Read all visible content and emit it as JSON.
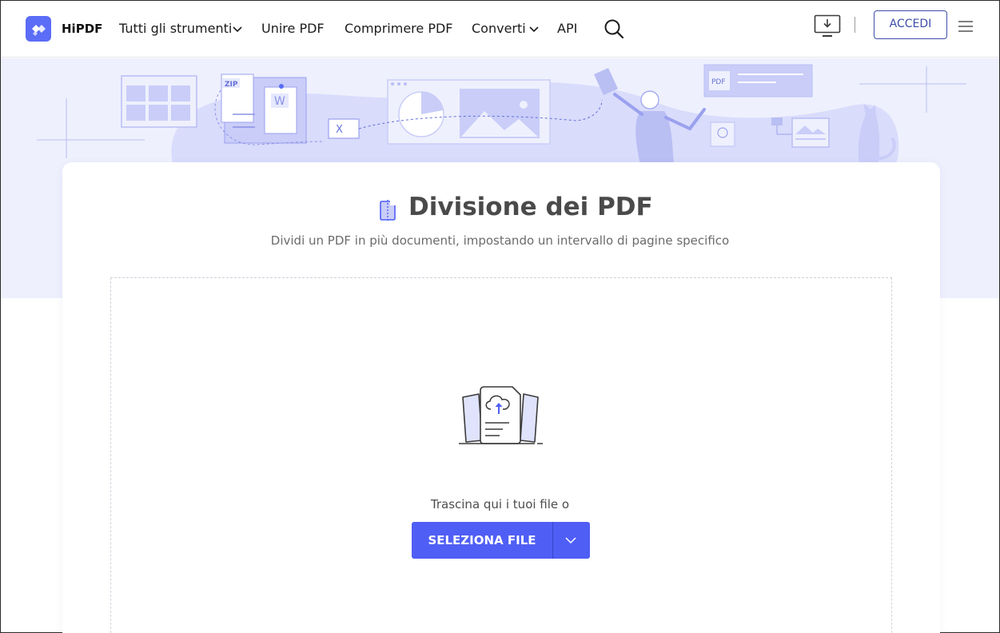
{
  "header": {
    "brand": "HiPDF",
    "nav": [
      {
        "label": "Tutti gli strumenti",
        "has_dropdown": true
      },
      {
        "label": "Unire PDF",
        "has_dropdown": false
      },
      {
        "label": "Comprimere PDF",
        "has_dropdown": false
      },
      {
        "label": "Converti",
        "has_dropdown": true
      },
      {
        "label": "API",
        "has_dropdown": false
      }
    ],
    "login_label": "ACCEDI",
    "icons": [
      "search-icon",
      "download-desktop-icon",
      "hamburger-menu-icon"
    ]
  },
  "hero": {
    "illustration_labels": {
      "zip": "ZIP",
      "pdf": "PDF",
      "word": "W",
      "excel": "X"
    }
  },
  "main": {
    "title": "Divisione dei PDF",
    "subtitle": "Dividi un PDF in più documenti, impostando un intervallo di pagine specifico",
    "drop_text": "Trascina qui i tuoi file o",
    "select_button_label": "SELEZIONA FILE"
  },
  "colors": {
    "accent": "#4f5ef5",
    "hero_bg": "#eef0fd",
    "login_border": "#3e4ea8",
    "title": "#4a4a4a"
  }
}
